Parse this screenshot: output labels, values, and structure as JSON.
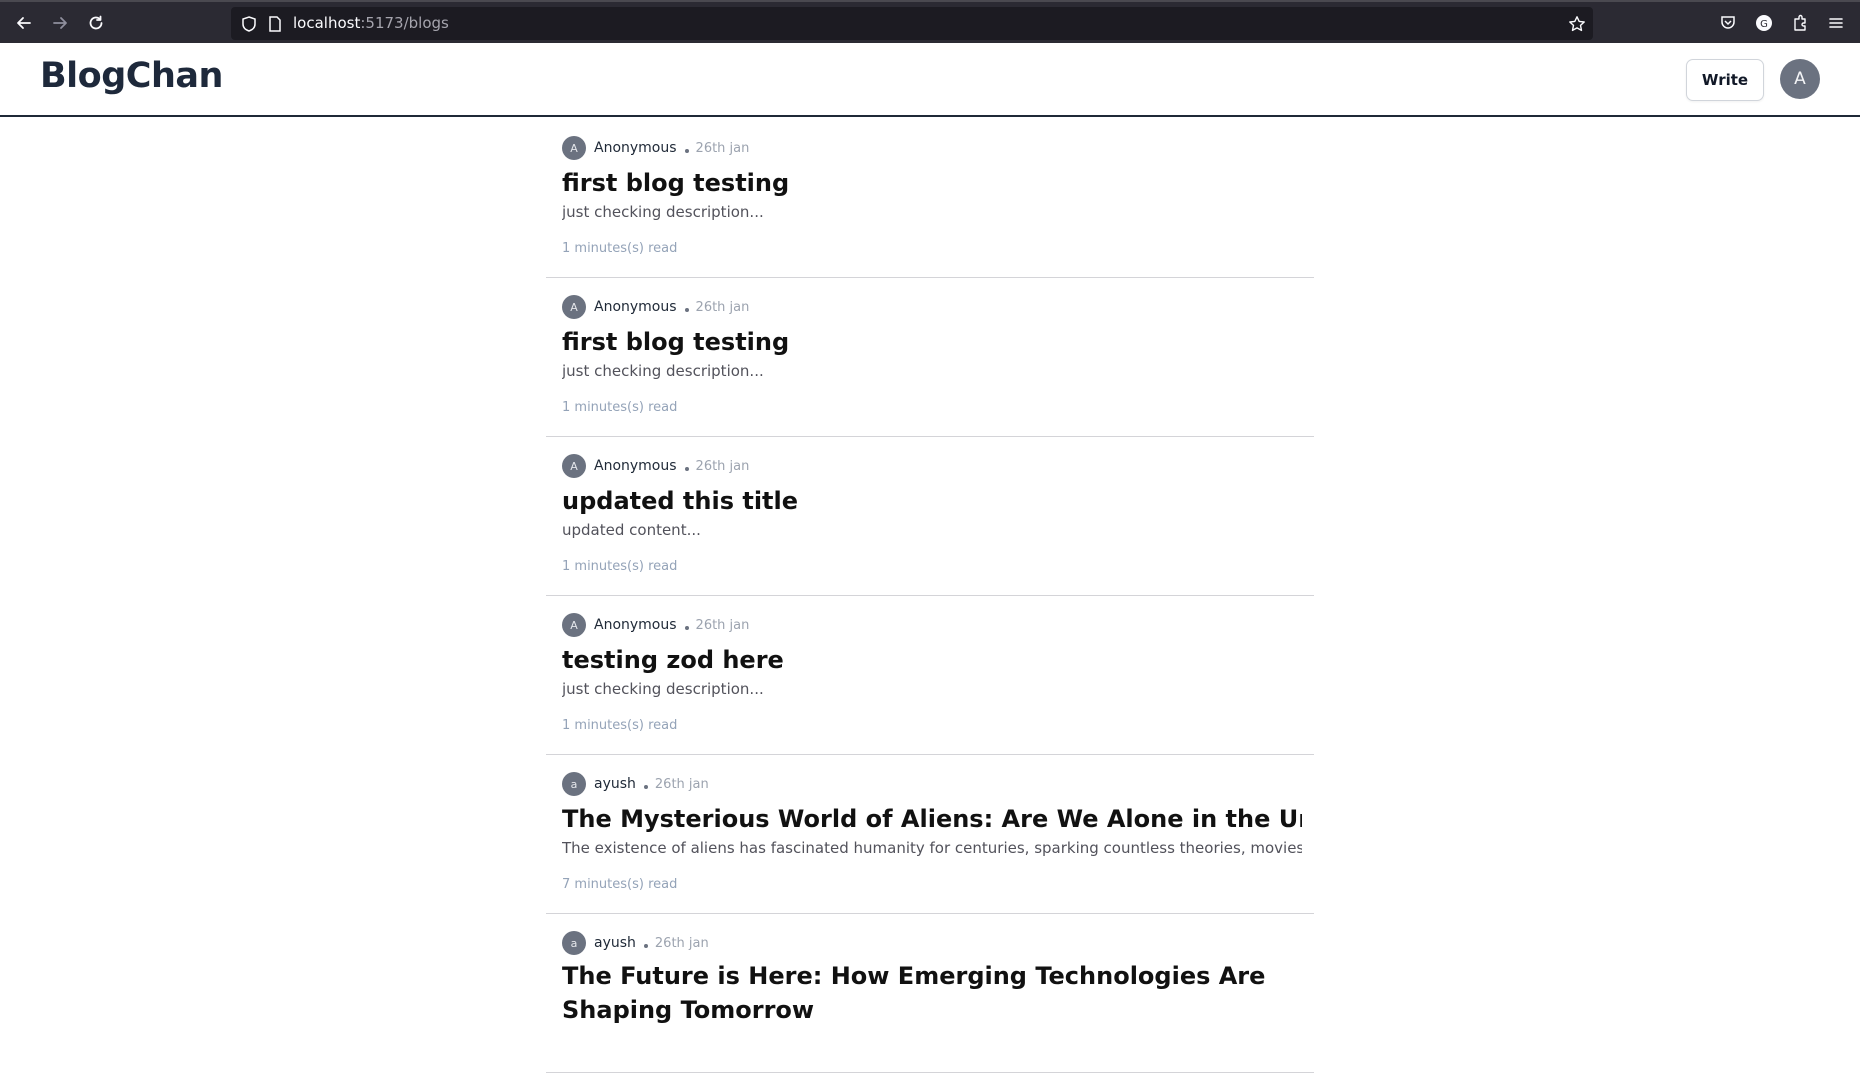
{
  "browser": {
    "url_host": "localhost",
    "url_rest": ":5173/blogs"
  },
  "app": {
    "brand": "BlogChan",
    "write_label": "Write",
    "user_initial": "A"
  },
  "posts": [
    {
      "avatar": "A",
      "author": "Anonymous",
      "date": "26th jan",
      "title": "first blog testing",
      "description": "just checking description...",
      "read_time": "1 minutes(s) read"
    },
    {
      "avatar": "A",
      "author": "Anonymous",
      "date": "26th jan",
      "title": "first blog testing",
      "description": "just checking description...",
      "read_time": "1 minutes(s) read"
    },
    {
      "avatar": "A",
      "author": "Anonymous",
      "date": "26th jan",
      "title": "updated this title",
      "description": "updated content...",
      "read_time": "1 minutes(s) read"
    },
    {
      "avatar": "A",
      "author": "Anonymous",
      "date": "26th jan",
      "title": "testing zod here",
      "description": "just checking description...",
      "read_time": "1 minutes(s) read"
    },
    {
      "avatar": "a",
      "author": "ayush",
      "date": "26th jan",
      "title": "The Mysterious World of Aliens: Are We Alone in the Universe?",
      "description": "The existence of aliens has fascinated humanity for centuries, sparking countless theories, movies, ...",
      "read_time": "7 minutes(s) read"
    },
    {
      "avatar": "a",
      "author": "ayush",
      "date": "26th jan",
      "title": "The Future is Here: How Emerging Technologies Are Shaping Tomorrow",
      "description": "",
      "read_time": ""
    }
  ]
}
